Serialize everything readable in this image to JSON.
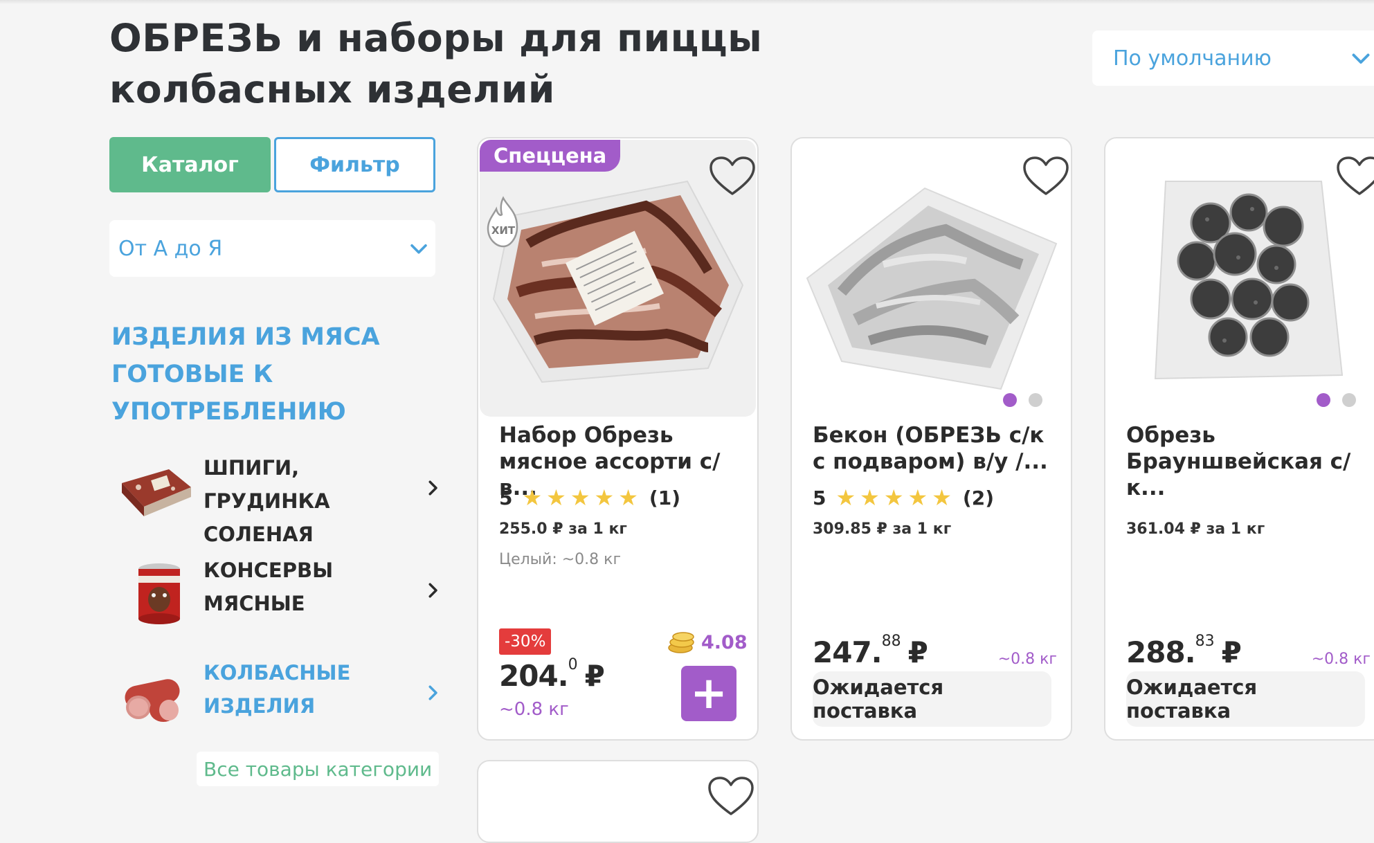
{
  "page_title": "ОБРЕЗЬ и наборы для пиццы колбасных изделий",
  "sort": {
    "selected": "По умолчанию"
  },
  "sidebar": {
    "catalog_button": "Каталог",
    "filter_button": "Фильтр",
    "alpha_sort": "От А до Я",
    "category_title": "ИЗДЕЛИЯ ИЗ МЯСА ГОТОВЫЕ К УПОТРЕБЛЕНИЮ",
    "subcategories": [
      {
        "label": "ШПИГИ, ГРУДИНКА СОЛЕНАЯ"
      },
      {
        "label": "КОНСЕРВЫ МЯСНЫЕ"
      },
      {
        "label": "КОЛБАСНЫЕ ИЗДЕЛИЯ"
      }
    ],
    "all_link": "Все товары категории"
  },
  "products": [
    {
      "badge": "Спеццена",
      "hit_label": "ХИТ",
      "name": "Набор Обрезь мясное ассорти с/в...",
      "rating": "5",
      "stars": "★★★★★",
      "reviews": "(1)",
      "price_per_kg": "255.0 ₽ за 1 кг",
      "whole_weight": "Целый: ~0.8 кг",
      "discount": "-30%",
      "bonus": "4.08",
      "price_main": "204.",
      "price_cents": "0",
      "currency": "₽",
      "weight": "~0.8 кг",
      "add_label": "+"
    },
    {
      "name": "Бекон (ОБРЕЗЬ с/к с подваром) в/у /...",
      "rating": "5",
      "stars": "★★★★★",
      "reviews": "(2)",
      "price_per_kg": "309.85 ₽ за 1 кг",
      "price_main": "247.",
      "price_cents": "88",
      "currency": "₽",
      "weight": "~0.8 кг",
      "status": "Ожидается поставка"
    },
    {
      "name": "Обрезь Брауншвейская с/к...",
      "price_per_kg": "361.04 ₽ за 1 кг",
      "price_main": "288.",
      "price_cents": "83",
      "currency": "₽",
      "weight": "~0.8 кг",
      "status": "Ожидается поставка"
    }
  ],
  "colors": {
    "accent_blue": "#4aa3dd",
    "accent_green": "#5fba8c",
    "accent_purple": "#a25cc9",
    "discount_red": "#e43c3c",
    "star_yellow": "#f3c63f"
  },
  "icons": [
    "heart-icon",
    "chevron-down-icon",
    "chevron-right-icon",
    "hit-flame-icon",
    "bonus-coins-icon"
  ]
}
